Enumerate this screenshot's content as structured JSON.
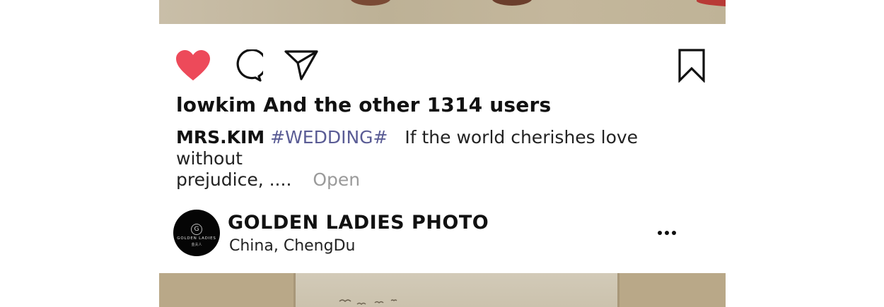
{
  "post": {
    "likes_text": "lowkim And the other 1314 users",
    "caption": {
      "author": "MRS.KIM",
      "hashtag": "#WEDDING#",
      "text_line1": "If the world cherishes love without",
      "text_line2": "prejudice, ....",
      "open_label": "Open"
    },
    "liked": true,
    "colors": {
      "like": "#ed4a5a",
      "hashtag": "#5a5c95",
      "open": "#9a9a9a"
    }
  },
  "next_post": {
    "account_name": "GOLDEN LADIES PHOTO",
    "location": "China,  ChengDu",
    "avatar": {
      "brand_mark": "G",
      "brand_name": "GOLDEN LADIES",
      "brand_sub": "金夫人"
    }
  },
  "icons": {
    "like": "heart-icon",
    "comment": "comment-bubble-icon",
    "share": "paper-plane-icon",
    "save": "bookmark-icon",
    "more": "more-dots-icon"
  }
}
